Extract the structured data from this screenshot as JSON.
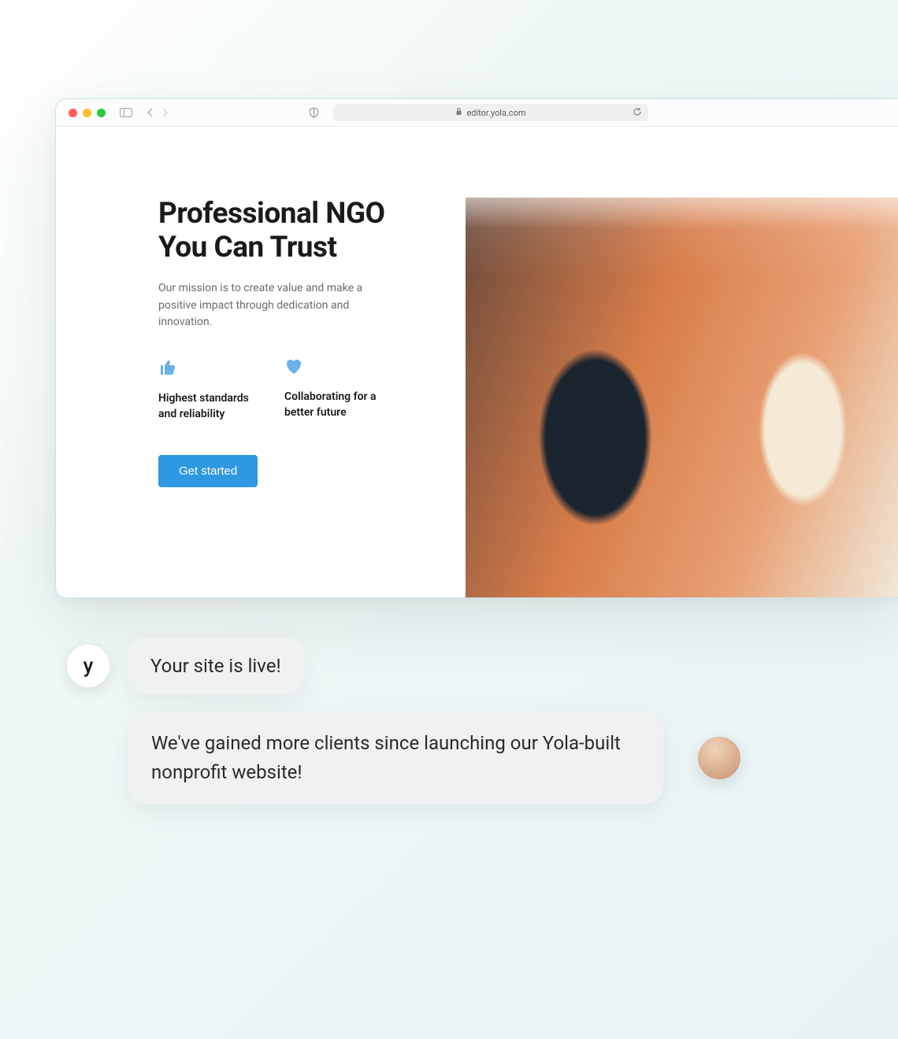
{
  "browser": {
    "url": "editor.yola.com"
  },
  "hero": {
    "title": "Professional NGO You Can Trust",
    "subtitle": "Our mission is to create value and make a positive impact through dedication and innovation.",
    "features": [
      {
        "label": "Highest standards and reliability"
      },
      {
        "label": "Collaborating for a better future"
      }
    ],
    "cta_label": "Get started"
  },
  "chat": {
    "yola_avatar_glyph": "y",
    "msg1": "Your site is live!",
    "msg2": "We've gained more clients since launching our Yola-built nonprofit website!"
  }
}
